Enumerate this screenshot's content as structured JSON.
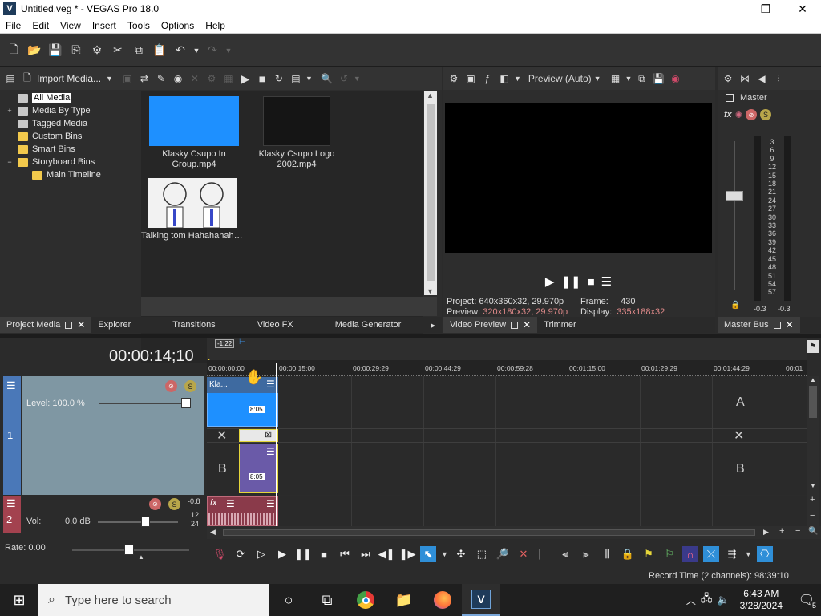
{
  "window": {
    "title": "Untitled.veg * - VEGAS Pro 18.0",
    "app_icon": "V",
    "min": "—",
    "max": "❐",
    "close": "✕"
  },
  "menu": [
    "File",
    "Edit",
    "View",
    "Insert",
    "Tools",
    "Options",
    "Help"
  ],
  "project_media": {
    "import_label": "Import Media...",
    "tree": [
      {
        "label": "All Media",
        "selected": true
      },
      {
        "label": "Media By Type",
        "expander": "+"
      },
      {
        "label": "Tagged Media"
      },
      {
        "label": "Custom Bins"
      },
      {
        "label": "Smart Bins"
      },
      {
        "label": "Storyboard Bins",
        "expander": "−"
      },
      {
        "label": "Main Timeline"
      }
    ],
    "media": [
      {
        "name": "Klasky Csupo In Group.mp4",
        "color": "#1e90ff"
      },
      {
        "name": "Klasky Csupo Logo 2002.mp4",
        "color": "#151515"
      },
      {
        "name": "Talking tom Hahahahahhaha Laugh...",
        "color": "#f2f2f2"
      }
    ]
  },
  "left_tabs": [
    "Project Media",
    "Explorer",
    "Transitions",
    "Video FX",
    "Media Generator"
  ],
  "preview": {
    "mode": "Preview (Auto)",
    "project_label": "Project:",
    "project_value": "640x360x32, 29.970p",
    "preview_label": "Preview:",
    "preview_value": "320x180x32, 29.970p",
    "frame_label": "Frame:",
    "frame_value": "430",
    "display_label": "Display:",
    "display_value": "335x188x32",
    "tabs": [
      "Video Preview",
      "Trimmer"
    ]
  },
  "master": {
    "label": "Master",
    "fx": "fx",
    "scale": [
      "3",
      "6",
      "9",
      "12",
      "15",
      "18",
      "21",
      "24",
      "27",
      "30",
      "33",
      "36",
      "39",
      "42",
      "45",
      "48",
      "51",
      "54",
      "57"
    ],
    "peak_left": "-0.3",
    "peak_right": "-0.3",
    "tab": "Master Bus"
  },
  "timeline": {
    "timecode": "00:00:14;10",
    "cursor_label": "-1:22",
    "ruler": [
      "00:00:00;00",
      "00:00:15:00",
      "00:00:29:29",
      "00:00:44:29",
      "00:00:59:28",
      "00:01:15:00",
      "00:01:29:29",
      "00:01:44:29",
      "00:01"
    ],
    "video_track": {
      "number": "1",
      "level": "Level: 100.0 %",
      "clip_label": "Kla...",
      "clip_duration": "8:05",
      "clip_duration_b": "8:05",
      "label_a": "A",
      "label_b": "B"
    },
    "audio_track": {
      "number": "2",
      "vol_label": "Vol:",
      "vol_value": "0.0 dB",
      "meter_top": "-0.8",
      "meter_12": "12",
      "meter_24": "24"
    },
    "rate": "Rate: 0.00"
  },
  "status": {
    "record_time": "Record Time (2 channels): 98:39:10"
  },
  "taskbar": {
    "search_placeholder": "Type here to search",
    "time": "6:43 AM",
    "date": "3/28/2024",
    "notification_count": "5"
  }
}
